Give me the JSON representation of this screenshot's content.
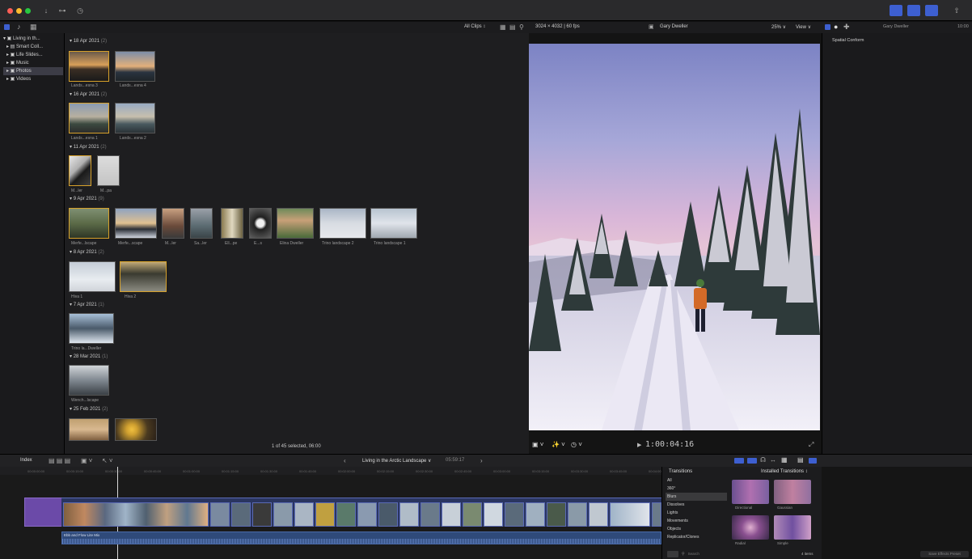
{
  "library": {
    "items": [
      {
        "label": "Living in th...",
        "selected": false
      },
      {
        "label": "Smart Coll...",
        "selected": false
      },
      {
        "label": "Life Slides...",
        "selected": false
      },
      {
        "label": "Music",
        "selected": false
      },
      {
        "label": "Photos",
        "selected": true
      },
      {
        "label": "Videos",
        "selected": false
      }
    ]
  },
  "browser": {
    "filter": "All Clips ↕",
    "format": "3024 × 4032 | 60 fps",
    "status": "1 of 45 selected, 06:00",
    "groups": [
      {
        "date": "18 Apr 2021",
        "count": "(2)",
        "captions": [
          "Lands...esna 3",
          "Lands...esna 4"
        ]
      },
      {
        "date": "16 Apr 2021",
        "count": "(2)",
        "captions": [
          "Lands...esna 1",
          "Lands...esna 2"
        ]
      },
      {
        "date": "11 Apr 2021",
        "count": "(2)",
        "captions": [
          "M...ler",
          "M...pa"
        ]
      },
      {
        "date": "9 Apr 2021",
        "count": "(9)",
        "captions": [
          "Merfe...lscape",
          "Merfe...scape",
          "M...ler",
          "Sa...ler",
          "Ell...pe",
          "E...s",
          "Elina Dweller",
          "Trino landscape 2",
          "Trino landscape 1"
        ]
      },
      {
        "date": "8 Apr 2021",
        "count": "(2)",
        "captions": [
          "Hiva 1",
          "Hiva 2"
        ]
      },
      {
        "date": "7 Apr 2021",
        "count": "(1)",
        "captions": [
          "Trino la...Dweller"
        ]
      },
      {
        "date": "28 Mar 2021",
        "count": "(1)",
        "captions": [
          "Wench...lscape"
        ]
      },
      {
        "date": "25 Feb 2021",
        "count": "(2)",
        "captions": []
      }
    ]
  },
  "viewer": {
    "clip_name": "Gary Dweller",
    "zoom": "25% ∨",
    "view": "View ∨",
    "timecode": "1:00:04:16"
  },
  "inspector": {
    "clip_name": "Gary Dweller",
    "duration": "10:00",
    "section": "Spatial Conform"
  },
  "timeline": {
    "index_label": "Index",
    "project": "Living in the Arctic Landscape ∨",
    "project_time": "05:59:17",
    "ruler_marks": [
      "00:00:00:00",
      "00:00:15:00",
      "00:00:30:00",
      "00:00:45:00",
      "00:01:00:00",
      "00:01:15:00",
      "00:01:30:00",
      "00:01:45:00",
      "00:02:00:00",
      "00:02:15:00",
      "00:02:30:00",
      "00:02:45:00",
      "00:03:00:00",
      "00:03:15:00",
      "00:03:30:00",
      "00:03:45:00",
      "00:04:00:00",
      "00:04:15:00"
    ],
    "audio_clip": "Ebb and Flow Lite Mix"
  },
  "effects": {
    "title": "Transitions",
    "installed": "Installed Transitions ↕",
    "categories": [
      "All",
      "360°",
      "Blurs",
      "Dissolves",
      "Lights",
      "Movements",
      "Objects",
      "Replicator/Clones"
    ],
    "selected_category": "Blurs",
    "items": [
      "Directional",
      "Gaussian",
      "Radial",
      "Simple"
    ],
    "search_placeholder": "Search",
    "count": "4 items",
    "save_button": "Save Effects Preset"
  },
  "colors": {
    "accent": "#3d5fd0",
    "selection": "#d7a12a",
    "clip_blue": "#34406e",
    "audio_blue": "#2f4a7a",
    "title_purple": "#6b4aa8"
  }
}
